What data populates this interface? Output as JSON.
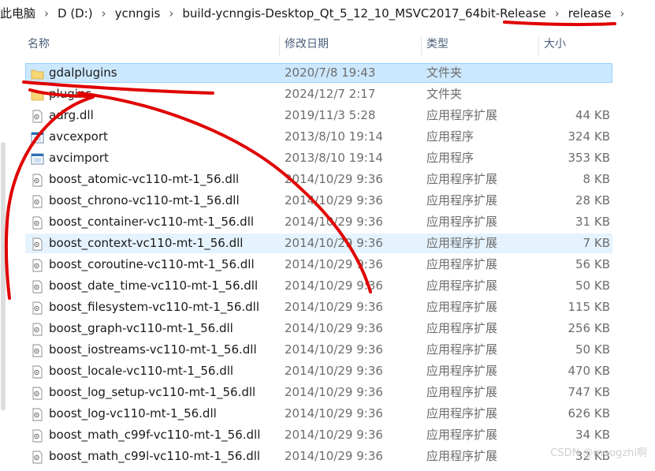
{
  "breadcrumb": [
    "此电脑",
    "D (D:)",
    "ycnngis",
    "build-ycnngis-Desktop_Qt_5_12_10_MSVC2017_64bit-Release",
    "release"
  ],
  "columns": {
    "name": "名称",
    "date": "修改日期",
    "type": "类型",
    "size": "大小"
  },
  "files": [
    {
      "name": "gdalplugins",
      "date": "2020/7/8 19:43",
      "type": "文件夹",
      "size": "",
      "icon": "folder-icon",
      "state": "selected"
    },
    {
      "name": "plugins",
      "date": "2024/12/7 2:17",
      "type": "文件夹",
      "size": "",
      "icon": "folder-icon",
      "state": ""
    },
    {
      "name": "adrg.dll",
      "date": "2019/11/3 5:28",
      "type": "应用程序扩展",
      "size": "44 KB",
      "icon": "dll-file-icon",
      "state": ""
    },
    {
      "name": "avcexport",
      "date": "2013/8/10 19:14",
      "type": "应用程序",
      "size": "324 KB",
      "icon": "exe-file-icon",
      "state": ""
    },
    {
      "name": "avcimport",
      "date": "2013/8/10 19:14",
      "type": "应用程序",
      "size": "353 KB",
      "icon": "exe-file-icon",
      "state": ""
    },
    {
      "name": "boost_atomic-vc110-mt-1_56.dll",
      "date": "2014/10/29 9:36",
      "type": "应用程序扩展",
      "size": "8 KB",
      "icon": "dll-file-icon",
      "state": ""
    },
    {
      "name": "boost_chrono-vc110-mt-1_56.dll",
      "date": "2014/10/29 9:36",
      "type": "应用程序扩展",
      "size": "28 KB",
      "icon": "dll-file-icon",
      "state": ""
    },
    {
      "name": "boost_container-vc110-mt-1_56.dll",
      "date": "2014/10/29 9:36",
      "type": "应用程序扩展",
      "size": "31 KB",
      "icon": "dll-file-icon",
      "state": ""
    },
    {
      "name": "boost_context-vc110-mt-1_56.dll",
      "date": "2014/10/29 9:36",
      "type": "应用程序扩展",
      "size": "7 KB",
      "icon": "dll-file-icon",
      "state": "hover"
    },
    {
      "name": "boost_coroutine-vc110-mt-1_56.dll",
      "date": "2014/10/29 9:36",
      "type": "应用程序扩展",
      "size": "56 KB",
      "icon": "dll-file-icon",
      "state": ""
    },
    {
      "name": "boost_date_time-vc110-mt-1_56.dll",
      "date": "2014/10/29 9:36",
      "type": "应用程序扩展",
      "size": "50 KB",
      "icon": "dll-file-icon",
      "state": ""
    },
    {
      "name": "boost_filesystem-vc110-mt-1_56.dll",
      "date": "2014/10/29 9:36",
      "type": "应用程序扩展",
      "size": "115 KB",
      "icon": "dll-file-icon",
      "state": ""
    },
    {
      "name": "boost_graph-vc110-mt-1_56.dll",
      "date": "2014/10/29 9:36",
      "type": "应用程序扩展",
      "size": "256 KB",
      "icon": "dll-file-icon",
      "state": ""
    },
    {
      "name": "boost_iostreams-vc110-mt-1_56.dll",
      "date": "2014/10/29 9:36",
      "type": "应用程序扩展",
      "size": "50 KB",
      "icon": "dll-file-icon",
      "state": ""
    },
    {
      "name": "boost_locale-vc110-mt-1_56.dll",
      "date": "2014/10/29 9:36",
      "type": "应用程序扩展",
      "size": "470 KB",
      "icon": "dll-file-icon",
      "state": ""
    },
    {
      "name": "boost_log_setup-vc110-mt-1_56.dll",
      "date": "2014/10/29 9:36",
      "type": "应用程序扩展",
      "size": "747 KB",
      "icon": "dll-file-icon",
      "state": ""
    },
    {
      "name": "boost_log-vc110-mt-1_56.dll",
      "date": "2014/10/29 9:36",
      "type": "应用程序扩展",
      "size": "626 KB",
      "icon": "dll-file-icon",
      "state": ""
    },
    {
      "name": "boost_math_c99f-vc110-mt-1_56.dll",
      "date": "2014/10/29 9:36",
      "type": "应用程序扩展",
      "size": "34 KB",
      "icon": "dll-file-icon",
      "state": ""
    },
    {
      "name": "boost_math_c99l-vc110-mt-1_56.dll",
      "date": "2014/10/29 9:36",
      "type": "应用程序扩展",
      "size": "32 KB",
      "icon": "dll-file-icon",
      "state": ""
    }
  ],
  "watermark": "CSDN @meogzhi啊",
  "colors": {
    "selection": "#cce8ff",
    "selection_border": "#99d1ff",
    "hover": "#e5f3ff",
    "annotation": "#e00000",
    "folder": "#f8d775"
  }
}
